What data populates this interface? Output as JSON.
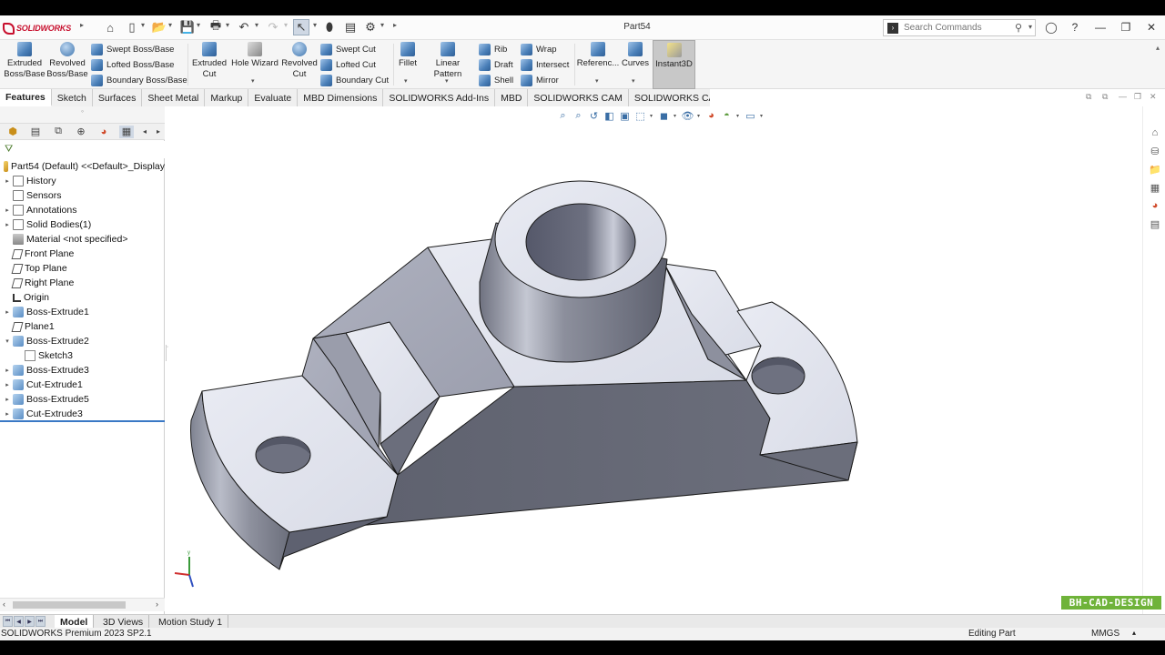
{
  "app": {
    "logo_text": "SOLIDWORKS",
    "document_title": "Part54",
    "search_placeholder": "Search Commands"
  },
  "ribbon": {
    "extruded_boss": "Extruded Boss/Base",
    "revolved_boss": "Revolved Boss/Base",
    "swept_boss": "Swept Boss/Base",
    "lofted_boss": "Lofted Boss/Base",
    "boundary_boss": "Boundary Boss/Base",
    "extruded_cut": "Extruded Cut",
    "hole_wizard": "Hole Wizard",
    "revolved_cut": "Revolved Cut",
    "swept_cut": "Swept Cut",
    "lofted_cut": "Lofted Cut",
    "boundary_cut": "Boundary Cut",
    "fillet": "Fillet",
    "linear_pattern": "Linear Pattern",
    "rib": "Rib",
    "draft": "Draft",
    "shell": "Shell",
    "wrap": "Wrap",
    "intersect": "Intersect",
    "mirror": "Mirror",
    "reference": "Referenc...",
    "curves": "Curves",
    "instant3d": "Instant3D"
  },
  "command_tabs": [
    "Features",
    "Sketch",
    "Surfaces",
    "Sheet Metal",
    "Markup",
    "Evaluate",
    "MBD Dimensions",
    "SOLIDWORKS Add-Ins",
    "MBD",
    "SOLIDWORKS CAM",
    "SOLIDWORKS CAM TBM"
  ],
  "tree": {
    "root": "Part54 (Default) <<Default>_Display",
    "items": [
      {
        "label": "History",
        "icon": "folder-icon",
        "expandable": true
      },
      {
        "label": "Sensors",
        "icon": "sensor-icon",
        "expandable": false
      },
      {
        "label": "Annotations",
        "icon": "annotation-icon",
        "expandable": true
      },
      {
        "label": "Solid Bodies(1)",
        "icon": "solid-bodies-icon",
        "expandable": true
      },
      {
        "label": "Material <not specified>",
        "icon": "material-icon",
        "expandable": false
      },
      {
        "label": "Front Plane",
        "icon": "plane-icon",
        "expandable": false
      },
      {
        "label": "Top Plane",
        "icon": "plane-icon",
        "expandable": false
      },
      {
        "label": "Right Plane",
        "icon": "plane-icon",
        "expandable": false
      },
      {
        "label": "Origin",
        "icon": "origin-icon",
        "expandable": false
      },
      {
        "label": "Boss-Extrude1",
        "icon": "extrude-icon",
        "expandable": true
      },
      {
        "label": "Plane1",
        "icon": "plane-icon",
        "expandable": false
      },
      {
        "label": "Boss-Extrude2",
        "icon": "extrude-icon",
        "expandable": true,
        "expanded": true
      },
      {
        "label": "Sketch3",
        "icon": "sketch-icon",
        "expandable": false,
        "child": true
      },
      {
        "label": "Boss-Extrude3",
        "icon": "extrude-icon",
        "expandable": true
      },
      {
        "label": "Cut-Extrude1",
        "icon": "cut-extrude-icon",
        "expandable": true
      },
      {
        "label": "Boss-Extrude5",
        "icon": "extrude-icon",
        "expandable": true
      },
      {
        "label": "Cut-Extrude3",
        "icon": "cut-extrude-icon",
        "expandable": true
      }
    ]
  },
  "bottom_tabs": [
    "Model",
    "3D Views",
    "Motion Study 1"
  ],
  "status": {
    "product": "SOLIDWORKS Premium 2023 SP2.1",
    "mode": "Editing Part",
    "units": "MMGS"
  },
  "watermark": "BH-CAD-DESIGN",
  "colors": {
    "accent": "#3a78c5",
    "watermark_bg": "#6fb33a",
    "logo_red": "#c8102e"
  }
}
